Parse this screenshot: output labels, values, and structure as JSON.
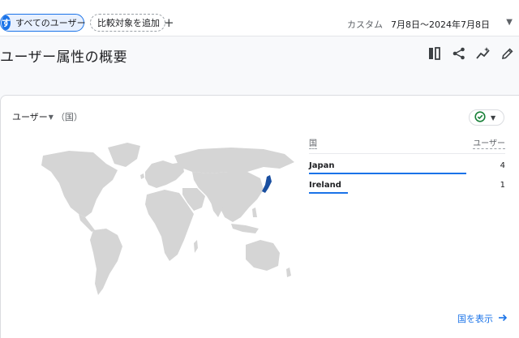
{
  "topbar": {
    "segment_chip": {
      "avatar_letter": "す",
      "label": "すべてのユーザー"
    },
    "add_compare": {
      "label": "比較対象を追加",
      "plus": "+"
    },
    "date": {
      "type": "カスタム",
      "range": "7月8日～2024年7月8日"
    }
  },
  "page": {
    "title": "ユーザー属性の概要",
    "toolbar_icons": [
      "compare-columns-icon",
      "share-icon",
      "insights-icon",
      "edit-icon"
    ]
  },
  "card": {
    "metric": "ユーザー",
    "dimension": "（国）",
    "status_icon": "check-circle-icon",
    "table": {
      "col_dimension": "国",
      "col_metric": "ユーザー",
      "rows": [
        {
          "name": "Japan",
          "value": "4",
          "share": 0.8
        },
        {
          "name": "Ireland",
          "value": "1",
          "share": 0.2
        }
      ]
    },
    "view_link": "国を表示"
  },
  "colors": {
    "accent": "#1a73e8",
    "map_land": "#d5d5d5",
    "map_highlight": "#1a4fa0",
    "positive": "#188038"
  }
}
